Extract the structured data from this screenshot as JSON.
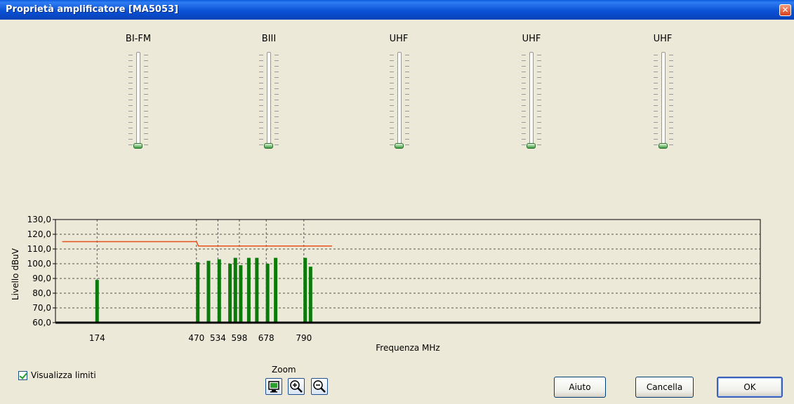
{
  "window": {
    "title": "Proprietà amplificatore [MA5053]",
    "close_glyph": "✕"
  },
  "sliders": [
    {
      "label": "BI-FM",
      "level": 0
    },
    {
      "label": "BIII",
      "level": 0
    },
    {
      "label": "UHF",
      "level": 0
    },
    {
      "label": "UHF",
      "level": 0
    },
    {
      "label": "UHF",
      "level": 0
    }
  ],
  "chart_data": {
    "type": "bar",
    "ylabel": "Livello dBuV",
    "xlabel": "Frequenza MHz",
    "ylim": [
      60,
      130
    ],
    "yticks": [
      "130,0",
      "120,0",
      "110,0",
      "100,0",
      "90,0",
      "80,0",
      "70,0",
      "60,0"
    ],
    "xlim": [
      50,
      2150
    ],
    "xtick_labels": [
      {
        "x": 174,
        "label": "174"
      },
      {
        "x": 470,
        "label": "470"
      },
      {
        "x": 534,
        "label": "534"
      },
      {
        "x": 598,
        "label": "598"
      },
      {
        "x": 678,
        "label": "678"
      },
      {
        "x": 790,
        "label": "790"
      }
    ],
    "bars": [
      {
        "x": 174,
        "y": 89
      },
      {
        "x": 474,
        "y": 101
      },
      {
        "x": 506,
        "y": 102
      },
      {
        "x": 538,
        "y": 103
      },
      {
        "x": 570,
        "y": 100
      },
      {
        "x": 586,
        "y": 104
      },
      {
        "x": 602,
        "y": 99
      },
      {
        "x": 626,
        "y": 104
      },
      {
        "x": 650,
        "y": 104
      },
      {
        "x": 682,
        "y": 100
      },
      {
        "x": 706,
        "y": 104
      },
      {
        "x": 794,
        "y": 104
      },
      {
        "x": 810,
        "y": 98
      }
    ],
    "limit_line": [
      {
        "x": 70,
        "y": 115
      },
      {
        "x": 470,
        "y": 115
      },
      {
        "x": 476,
        "y": 112
      },
      {
        "x": 874,
        "y": 112
      }
    ],
    "grid": true,
    "bar_color": "#0a7a0a",
    "limit_color": "#e8501c"
  },
  "options": {
    "show_limits_label": "Visualizza limiti",
    "show_limits_checked": true
  },
  "zoom": {
    "label": "Zoom",
    "buttons": [
      {
        "icon": "fit-screen-icon"
      },
      {
        "icon": "zoom-in-icon"
      },
      {
        "icon": "zoom-out-icon"
      }
    ]
  },
  "buttons": {
    "help": "Aiuto",
    "cancel": "Cancella",
    "ok": "OK"
  }
}
